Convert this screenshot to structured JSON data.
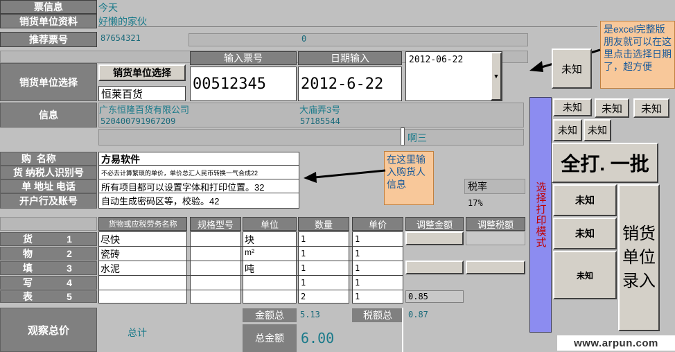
{
  "top": {
    "ticket_info_label": "票信息",
    "ticket_info_value": "今天",
    "seller_info_label": "销货单位资料",
    "seller_info_value": "好懒的家伙",
    "recommend_label": "推荐票号",
    "recommend_value": "87654321",
    "recommend_value2": "0"
  },
  "seller_select": {
    "label": "销货单位选择",
    "button": "销货单位选择",
    "selected": "恒莱百货",
    "ticket_no_header": "输入票号",
    "ticket_no": "00512345",
    "date_header": "日期输入",
    "date_value": "2012-6-22",
    "date_dropdown": "2012-06-22"
  },
  "info": {
    "label": "信息",
    "company": "广东恒隆百货有限公司",
    "address": "大庙弄3号",
    "taxid": "520400791967209",
    "phone": "57185544",
    "extra": "啊三"
  },
  "buyer": {
    "row1_label": "购  名称",
    "row2_label": "货 纳税人识别号",
    "row3_label": "单 地址 电话",
    "row4_label": "开户行及账号",
    "name": "方易软件",
    "taxid_note": "不必去计算繁琐的单价，单价总汇人民币转换一气合成22",
    "addr": "所有项目都可以设置字体和打印位置。32",
    "bank": "自动生成密码区等，校验。42",
    "tax_rate_label": "税率",
    "tax_rate": "17%"
  },
  "notes": {
    "top_note": "是excel完整版朋友就可以在这里点击选择日期了，超方便",
    "buyer_note": "在这里输入购货人信息"
  },
  "goods": {
    "headers": [
      "货物或应税劳务名称",
      "规格型号",
      "单位",
      "数量",
      "单价",
      "调整金额",
      "调整税额"
    ],
    "side_labels": [
      "货",
      "物",
      "填",
      "写",
      "表"
    ],
    "row_numbers": [
      "1",
      "2",
      "3",
      "4",
      "5"
    ],
    "rows": [
      {
        "name": "尽快",
        "unit": "块",
        "qty": "1",
        "price": "1"
      },
      {
        "name": "瓷砖",
        "unit": "m²",
        "qty": "1",
        "price": "1"
      },
      {
        "name": "水泥",
        "unit": "吨",
        "qty": "1",
        "price": "1"
      },
      {
        "name": "",
        "unit": "",
        "qty": "1",
        "price": "1"
      },
      {
        "name": "",
        "unit": "",
        "qty": "2",
        "price": "1",
        "adj": "0.85"
      }
    ]
  },
  "totals": {
    "observe_label": "观察总价",
    "total_label": "总计",
    "amount_label": "金额总",
    "amount_value": "5.13",
    "tax_label": "税额总",
    "tax_value": "0.87",
    "grand_label": "总金额",
    "grand_value": "6.00"
  },
  "right_panel": {
    "unknown_big": "未知",
    "mode_label": "选择打印模式",
    "small_buttons": [
      "未知",
      "未知",
      "未知",
      "未知",
      "未知"
    ],
    "print_all": "全打. 一批",
    "stack_buttons": [
      "未知",
      "未知",
      "未知"
    ],
    "seller_entry": "销货单位录入",
    "watermark": "www.arpun.com"
  }
}
